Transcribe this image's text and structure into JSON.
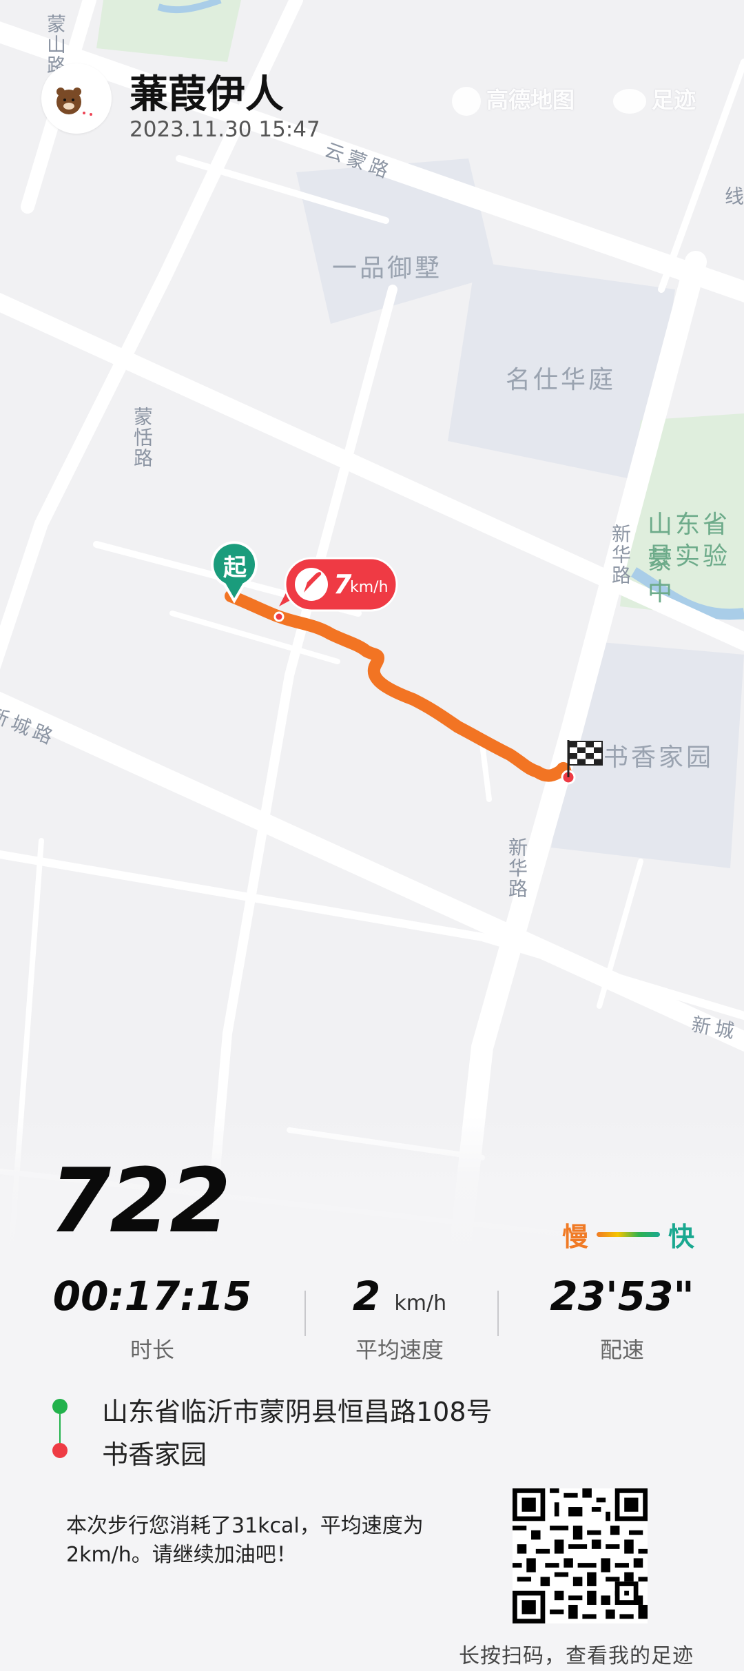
{
  "user": {
    "name": "蒹葭伊人",
    "datetime": "2023.11.30 15:47"
  },
  "watermark": {
    "amap": "高德地图",
    "footprint": "足迹"
  },
  "map": {
    "places": [
      "一品御墅",
      "名仕华庭",
      "山东省蒙",
      "县实验中",
      "书香家园"
    ],
    "roads": {
      "yunmeng": "云蒙路",
      "mengtian": "蒙恬路",
      "xinhua_top": "新华路",
      "xinhua_bottom": "新华路",
      "xincheng_left": "新城路",
      "xincheng_right": "新城",
      "mengshan": "蒙山路",
      "xian": "线"
    },
    "start_marker": "起",
    "speed_badge": "7",
    "speed_badge_unit": "km/h"
  },
  "stats": {
    "steps": "722",
    "legend_slow": "慢",
    "legend_fast": "快",
    "duration": {
      "value": "00:17:15",
      "label": "时长"
    },
    "avg_speed": {
      "value": "2",
      "unit": "km/h",
      "label": "平均速度"
    },
    "pace": {
      "value": "23'53\"",
      "label": "配速"
    }
  },
  "route": {
    "start": "山东省临沂市蒙阴县恒昌路108号",
    "end": "书香家园",
    "start_color": "#22b24c",
    "end_color": "#ee3b44"
  },
  "summary": "本次步行您消耗了31kcal，平均速度为2km/h。请继续加油吧！",
  "qr_hint": "长按扫码，查看我的足迹",
  "colors": {
    "track": "#f27423",
    "start_marker": "#1a9c7c",
    "speed_badge": "#ef3a44"
  }
}
